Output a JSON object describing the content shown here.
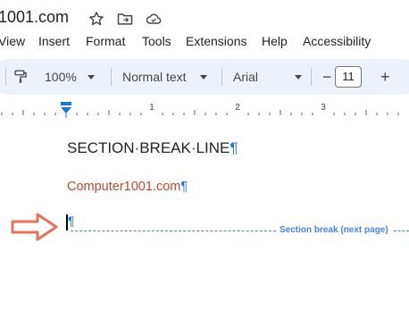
{
  "document": {
    "title": "1001.com"
  },
  "menu": [
    "View",
    "Insert",
    "Format",
    "Tools",
    "Extensions",
    "Help",
    "Accessibility"
  ],
  "toolbar": {
    "zoom": "100%",
    "paragraph_style": "Normal text",
    "font": "Arial",
    "font_size": "11",
    "decrease_label": "−",
    "increase_label": "+"
  },
  "ruler": {
    "marks": [
      "1",
      "2",
      "3"
    ]
  },
  "page": {
    "heading": "SECTION·BREAK·LINE",
    "subtitle": "Computer1001.com",
    "pilcrow": "¶",
    "section_break_label": "Section break (next page)"
  },
  "colors": {
    "subtitle": "#c0482b",
    "pilcrow": "#1a73e8",
    "section_break": "#4285f4",
    "arrow": "#e8735a",
    "toolbar_bg": "#edf2fa"
  },
  "icons": [
    "star-icon",
    "move-to-folder-icon",
    "cloud-saved-icon",
    "paint-format-icon",
    "chevron-down-icon",
    "indent-marker-icon",
    "arrow-right-icon"
  ]
}
